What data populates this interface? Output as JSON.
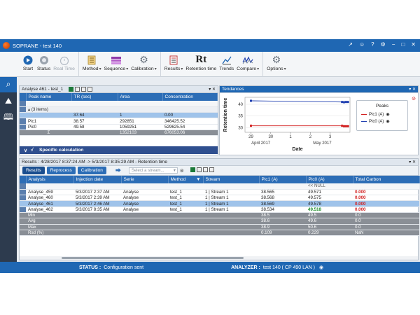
{
  "window": {
    "title": "SOPRANE - test 140"
  },
  "ribbon": {
    "buttons": [
      {
        "label": "Start"
      },
      {
        "label": "Status"
      },
      {
        "label": "Real Time"
      },
      {
        "label": "Method"
      },
      {
        "label": "Sequence"
      },
      {
        "label": "Calibration"
      },
      {
        "label": "Results"
      },
      {
        "label": "Retention time"
      },
      {
        "label": "Trends"
      },
      {
        "label": "Compare"
      },
      {
        "label": "Options"
      }
    ],
    "rt_glyph": "Rt"
  },
  "peak_panel": {
    "title": "Analyse 461 - test_1",
    "columns": [
      "Peak name",
      "TR (sec)",
      "Area",
      "Concentration"
    ],
    "group_row": "(3 items)",
    "rows": [
      [
        "",
        "37.64",
        "1",
        "0.00"
      ],
      [
        "Pic1",
        "38.57",
        "292851",
        "346425.52"
      ],
      [
        "Pic0",
        "49.58",
        "1059251",
        "529625.54"
      ],
      [
        "Σ",
        "",
        "1352103",
        "676053.06"
      ]
    ],
    "specific_label": "Specific calculation"
  },
  "trend_panel": {
    "title": "Tendances",
    "legend_title": "Peaks",
    "legend_items": [
      "Pic1 (A)",
      "Pic0 (A)"
    ]
  },
  "chart_data": {
    "type": "line",
    "ylabel": "Retention time",
    "xlabel": "Date",
    "y_ticks": [
      40,
      35,
      30
    ],
    "ylim": [
      28,
      43
    ],
    "x_ticks": [
      "29",
      "30",
      "1",
      "2",
      "3"
    ],
    "x_groups": [
      "April 2017",
      "May 2017"
    ],
    "series": [
      {
        "name": "Pic1 (A)",
        "color": "#d21f1f",
        "x": [
          0,
          4.6,
          4.7,
          4.8,
          4.9
        ],
        "y": [
          30.8,
          30.8,
          30.6,
          30.6,
          30.6
        ]
      },
      {
        "name": "Pic0 (A)",
        "color": "#1f3fb0",
        "x": [
          0,
          4.6,
          4.7,
          4.8,
          4.9
        ],
        "y": [
          41.5,
          41.0,
          40.9,
          41.0,
          41.0
        ]
      }
    ]
  },
  "results_panel": {
    "title": "Results : 4/28/2017 8:37:24 AM -> 5/3/2017 8:35:29 AM - Retention time",
    "tabs": [
      "Results",
      "Reprocess",
      "Calibration"
    ],
    "search_placeholder": "Select a stream...",
    "columns": [
      "Analysis",
      "Injection date",
      "Serie",
      "Method",
      "Stream",
      "Pic1 (A)",
      "Pic0 (A)",
      "Total Carbon"
    ],
    "filter_null": "<< NULL",
    "rows": [
      [
        "Analyse_459",
        "5/3/2017 2:37 AM",
        "Analyse",
        "test_1",
        "1 | Stream 1",
        "38.565",
        "49.571",
        "0.000"
      ],
      [
        "Analyse_460",
        "5/3/2017 2:39 AM",
        "Analyse",
        "test_1",
        "1 | Stream 1",
        "38.568",
        "49.575",
        "0.000"
      ],
      [
        "Analyse_461",
        "5/3/2017 2:46 AM",
        "Analyse",
        "test_1",
        "1 | Stream 1",
        "38.569",
        "49.578",
        "0.000"
      ],
      [
        "Analyse_462",
        "5/3/2017 8:35 AM",
        "Analyse",
        "test_1",
        "1 | Stream 1",
        "38.534",
        "49.518",
        "0.000"
      ]
    ],
    "stats": [
      [
        "Min",
        "38.5",
        "49.5",
        "0.0"
      ],
      [
        "Avg",
        "38.6",
        "49.6",
        "0.0"
      ],
      [
        "Max",
        "38.9",
        "50.6",
        "0.0"
      ],
      [
        "Rsd (%)",
        "0.109",
        "0.229",
        "NaN"
      ]
    ]
  },
  "statusbar": {
    "status_label": "STATUS :",
    "status_value": "Configuration sent",
    "analyzer_label": "ANALYZER :",
    "analyzer_value": "test 140 ( CP 490 LAN )"
  },
  "colors": {
    "accent": "#1f67b3",
    "nav": "#2d3b4e",
    "header": "#2c6db6",
    "selected": "#9fc3ea"
  }
}
